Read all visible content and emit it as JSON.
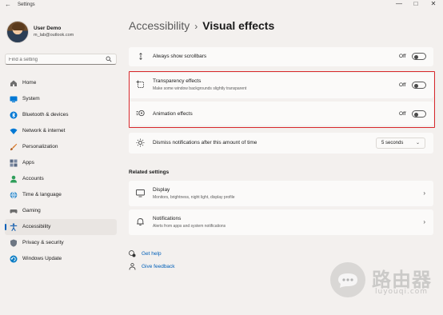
{
  "window": {
    "title": "Settings",
    "back_glyph": "←",
    "minimize_glyph": "—",
    "maximize_glyph": "□",
    "close_glyph": "✕"
  },
  "profile": {
    "name": "User Demo",
    "email": "m_lab@outlook.com"
  },
  "search": {
    "placeholder": "Find a setting",
    "icon": "search-icon"
  },
  "sidebar": {
    "items": [
      {
        "label": "Home",
        "icon": "home-icon",
        "color": "#6d6d6d"
      },
      {
        "label": "System",
        "icon": "system-icon",
        "color": "#0078d4"
      },
      {
        "label": "Bluetooth & devices",
        "icon": "bluetooth-icon",
        "color": "#0078d4"
      },
      {
        "label": "Network & internet",
        "icon": "wifi-icon",
        "color": "#0078d4"
      },
      {
        "label": "Personalization",
        "icon": "brush-icon",
        "color": "#d87a2c"
      },
      {
        "label": "Apps",
        "icon": "apps-icon",
        "color": "#5a6a84"
      },
      {
        "label": "Accounts",
        "icon": "accounts-icon",
        "color": "#2f9e5a"
      },
      {
        "label": "Time & language",
        "icon": "globe-icon",
        "color": "#2a86c8"
      },
      {
        "label": "Gaming",
        "icon": "gaming-icon",
        "color": "#6d6d6d"
      },
      {
        "label": "Accessibility",
        "icon": "accessibility-icon",
        "color": "#1a62b0",
        "active": true
      },
      {
        "label": "Privacy & security",
        "icon": "shield-icon",
        "color": "#6d7683"
      },
      {
        "label": "Windows Update",
        "icon": "update-icon",
        "color": "#0a7cc4"
      }
    ]
  },
  "breadcrumb": {
    "parent": "Accessibility",
    "separator": "›",
    "current": "Visual effects"
  },
  "settings": {
    "scrollbars": {
      "title": "Always show scrollbars",
      "state": "Off",
      "icon": "scrollbar-icon"
    },
    "transparency": {
      "title": "Transparency effects",
      "subtitle": "Make some window backgrounds slightly transparent",
      "state": "Off",
      "icon": "transparency-icon"
    },
    "animation": {
      "title": "Animation effects",
      "state": "Off",
      "icon": "animation-icon"
    },
    "notifications_dismiss": {
      "title": "Dismiss notifications after this amount of time",
      "value": "5 seconds",
      "icon": "sun-icon"
    }
  },
  "related": {
    "heading": "Related settings",
    "items": [
      {
        "title": "Display",
        "subtitle": "Monitors, brightness, night light, display profile",
        "icon": "monitor-icon"
      },
      {
        "title": "Notifications",
        "subtitle": "Alerts from apps and system notifications",
        "icon": "bell-icon"
      }
    ],
    "chevron": "›"
  },
  "links": {
    "help": {
      "label": "Get help",
      "icon": "help-icon"
    },
    "feedback": {
      "label": "Give feedback",
      "icon": "feedback-icon"
    }
  },
  "watermark": {
    "cn": "路由器",
    "en": "luyouqi.com"
  },
  "colors": {
    "accent": "#005fb8",
    "highlight_border": "#d8282c",
    "background": "#f3f0ee",
    "card": "#fbfaf9"
  }
}
